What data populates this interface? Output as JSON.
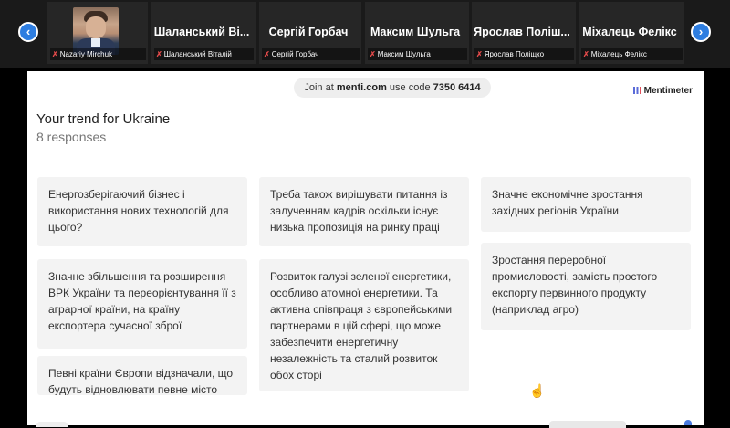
{
  "meeting": {
    "participants": [
      {
        "title": "",
        "name": "Nazariy Mirchuk"
      },
      {
        "title": "Шаланський Ві...",
        "name": "Шаланський Віталій"
      },
      {
        "title": "Сергій Горбач",
        "name": "Сергій Горбач"
      },
      {
        "title": "Максим Шульга",
        "name": "Максим Шульга"
      },
      {
        "title": "Ярослав Поліш...",
        "name": "Ярослав Поліщко"
      },
      {
        "title": "Міхалець Фелікс",
        "name": "Міхалець Фелікс"
      }
    ],
    "prev_icon": "chevron-left-icon",
    "next_icon": "chevron-right-icon",
    "muted_icon": "mic-off-icon"
  },
  "slide": {
    "join_prefix": "Join at",
    "join_site": "menti.com",
    "join_mid": "use code",
    "join_code": "7350 6414",
    "brand": "Mentimeter",
    "title": "Your trend for Ukraine",
    "responses": "8 responses",
    "cards": [
      "Енергозберігаючий бізнес і використання нових технологій для цього?",
      "Значне збільшення та розширення ВРК України та переорієнтування її з аграрної країни, на країну експортера сучасної зброї",
      "Певні країни Європи відзначали, що будуть відновлювати певне місто",
      "Треба також вирішувати питання із залученням кадрів оскільки існує низька пропозиція на ринку праці",
      "Розвиток галузі зеленої енергетики, особливо атомної енергетики. Та активна співпраця з європейськими партнерами в цій сфері, що може забезпечити енергетичну незалежність та сталий розвиток обох сторі",
      "Значне економічне зростання західних регіонів України",
      "Зростання переробної промисловості, замість простого експорту первинного продукту (наприклад агро)"
    ]
  },
  "colors": {
    "accent": "#2d7de0",
    "muted_mic": "#e24a4a"
  }
}
